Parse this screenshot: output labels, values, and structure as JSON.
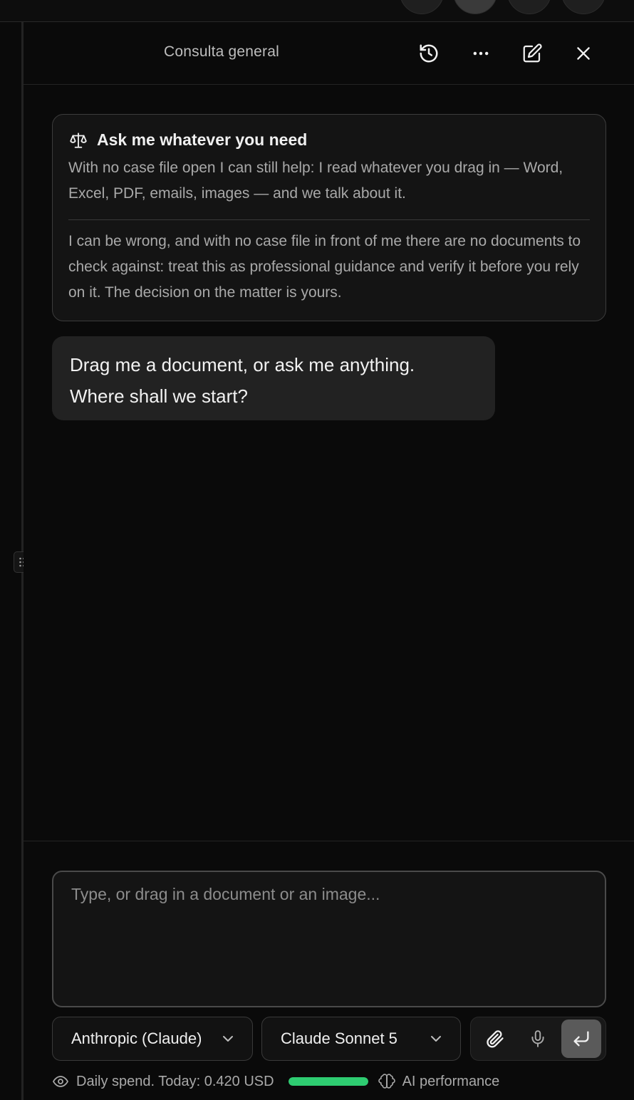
{
  "header": {
    "title": "Consulta general"
  },
  "intro": {
    "title": "Ask me whatever you need",
    "body": "With no case file open I can still help: I read whatever you drag in — Word, Excel, PDF, emails, images — and we talk about it.",
    "disclaimer": "I can be wrong, and with no case file in front of me there are no documents to check against: treat this as professional guidance and verify it before you rely on it. The decision on the matter is yours."
  },
  "message": {
    "line1": "Drag me a document, or ask me anything.",
    "line2": "Where shall we start?"
  },
  "composer": {
    "placeholder": "Type, or drag in a document or an image..."
  },
  "provider_select": {
    "value": "Anthropic (Claude)"
  },
  "model_select": {
    "value": "Claude Sonnet 5"
  },
  "footer": {
    "spend": "Daily spend. Today: 0.420 USD",
    "spend_level": 1.0,
    "performance": "AI performance"
  },
  "colors": {
    "meter": "#2ecc71",
    "background": "#0a0a0a"
  },
  "icons": [
    "history-icon",
    "more-icon",
    "edit-icon",
    "close-icon",
    "scale-icon",
    "chevron-down-icon",
    "paperclip-icon",
    "microphone-icon",
    "enter-icon",
    "eye-icon",
    "brain-icon",
    "grip-icon"
  ]
}
